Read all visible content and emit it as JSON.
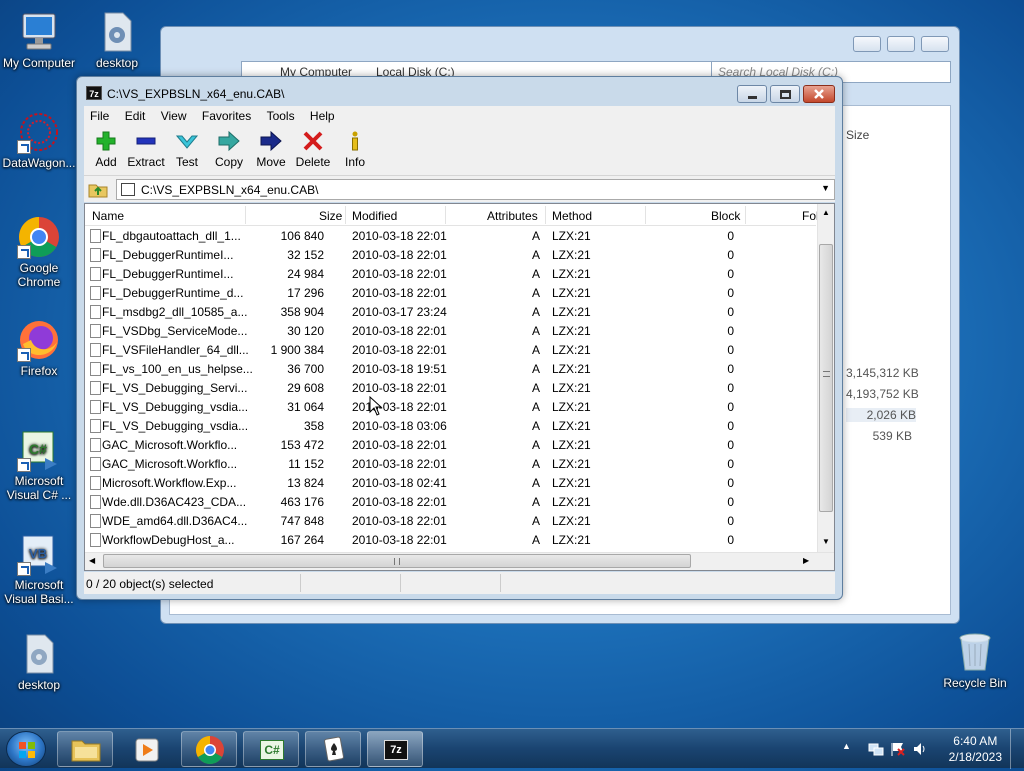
{
  "desktop": {
    "icons": [
      {
        "label": "My Computer"
      },
      {
        "label": "desktop"
      },
      {
        "label": "DataWagon..."
      },
      {
        "label": "Google Chrome"
      },
      {
        "label": "Firefox"
      },
      {
        "label": "Microsoft Visual C# ..."
      },
      {
        "label": "Microsoft Visual Basi..."
      },
      {
        "label": "desktop"
      },
      {
        "label": "Recycle Bin"
      }
    ]
  },
  "explorer": {
    "breadcrumb": [
      "My Computer",
      "Local Disk (C:)"
    ],
    "search_placeholder": "Search Local Disk (C:)",
    "col_size": "Size",
    "sizes": [
      "3,145,312 KB",
      "4,193,752 KB",
      "2,026 KB",
      "539 KB"
    ]
  },
  "zip": {
    "title": "C:\\VS_EXPBSLN_x64_enu.CAB\\",
    "icon_text": "7z",
    "menu": [
      "File",
      "Edit",
      "View",
      "Favorites",
      "Tools",
      "Help"
    ],
    "toolbar": [
      "Add",
      "Extract",
      "Test",
      "Copy",
      "Move",
      "Delete",
      "Info"
    ],
    "address": "C:\\VS_EXPBSLN_x64_enu.CAB\\",
    "columns": [
      "Name",
      "Size",
      "Modified",
      "Attributes",
      "Method",
      "Block",
      "Fol"
    ],
    "rows": [
      {
        "name": "FL_dbgautoattach_dll_1...",
        "size": "106 840",
        "modified": "2010-03-18 22:01",
        "attr": "A",
        "method": "LZX:21",
        "block": "0"
      },
      {
        "name": "FL_DebuggerRuntimeI...",
        "size": "32 152",
        "modified": "2010-03-18 22:01",
        "attr": "A",
        "method": "LZX:21",
        "block": "0"
      },
      {
        "name": "FL_DebuggerRuntimeI...",
        "size": "24 984",
        "modified": "2010-03-18 22:01",
        "attr": "A",
        "method": "LZX:21",
        "block": "0"
      },
      {
        "name": "FL_DebuggerRuntime_d...",
        "size": "17 296",
        "modified": "2010-03-18 22:01",
        "attr": "A",
        "method": "LZX:21",
        "block": "0"
      },
      {
        "name": "FL_msdbg2_dll_10585_a...",
        "size": "358 904",
        "modified": "2010-03-17 23:24",
        "attr": "A",
        "method": "LZX:21",
        "block": "0"
      },
      {
        "name": "FL_VSDbg_ServiceMode...",
        "size": "30 120",
        "modified": "2010-03-18 22:01",
        "attr": "A",
        "method": "LZX:21",
        "block": "0"
      },
      {
        "name": "FL_VSFileHandler_64_dll...",
        "size": "1 900 384",
        "modified": "2010-03-18 22:01",
        "attr": "A",
        "method": "LZX:21",
        "block": "0"
      },
      {
        "name": "FL_vs_100_en_us_helpse...",
        "size": "36 700",
        "modified": "2010-03-18 19:51",
        "attr": "A",
        "method": "LZX:21",
        "block": "0"
      },
      {
        "name": "FL_VS_Debugging_Servi...",
        "size": "29 608",
        "modified": "2010-03-18 22:01",
        "attr": "A",
        "method": "LZX:21",
        "block": "0"
      },
      {
        "name": "FL_VS_Debugging_vsdia...",
        "size": "31 064",
        "modified": "2010-03-18 22:01",
        "attr": "A",
        "method": "LZX:21",
        "block": "0"
      },
      {
        "name": "FL_VS_Debugging_vsdia...",
        "size": "358",
        "modified": "2010-03-18 03:06",
        "attr": "A",
        "method": "LZX:21",
        "block": "0"
      },
      {
        "name": "GAC_Microsoft.Workflo...",
        "size": "153 472",
        "modified": "2010-03-18 22:01",
        "attr": "A",
        "method": "LZX:21",
        "block": "0"
      },
      {
        "name": "GAC_Microsoft.Workflo...",
        "size": "11 152",
        "modified": "2010-03-18 22:01",
        "attr": "A",
        "method": "LZX:21",
        "block": "0"
      },
      {
        "name": "Microsoft.Workflow.Exp...",
        "size": "13 824",
        "modified": "2010-03-18 02:41",
        "attr": "A",
        "method": "LZX:21",
        "block": "0"
      },
      {
        "name": "Wde.dll.D36AC423_CDA...",
        "size": "463 176",
        "modified": "2010-03-18 22:01",
        "attr": "A",
        "method": "LZX:21",
        "block": "0"
      },
      {
        "name": "WDE_amd64.dll.D36AC4...",
        "size": "747 848",
        "modified": "2010-03-18 22:01",
        "attr": "A",
        "method": "LZX:21",
        "block": "0"
      },
      {
        "name": "WorkflowDebugHost_a...",
        "size": "167 264",
        "modified": "2010-03-18 22:01",
        "attr": "A",
        "method": "LZX:21",
        "block": "0"
      }
    ],
    "status": "0 / 20 object(s) selected"
  },
  "taskbar": {
    "time": "6:40 AM",
    "date": "2/18/2023",
    "c_sharp_label": "C#",
    "zip_label": "7z"
  }
}
